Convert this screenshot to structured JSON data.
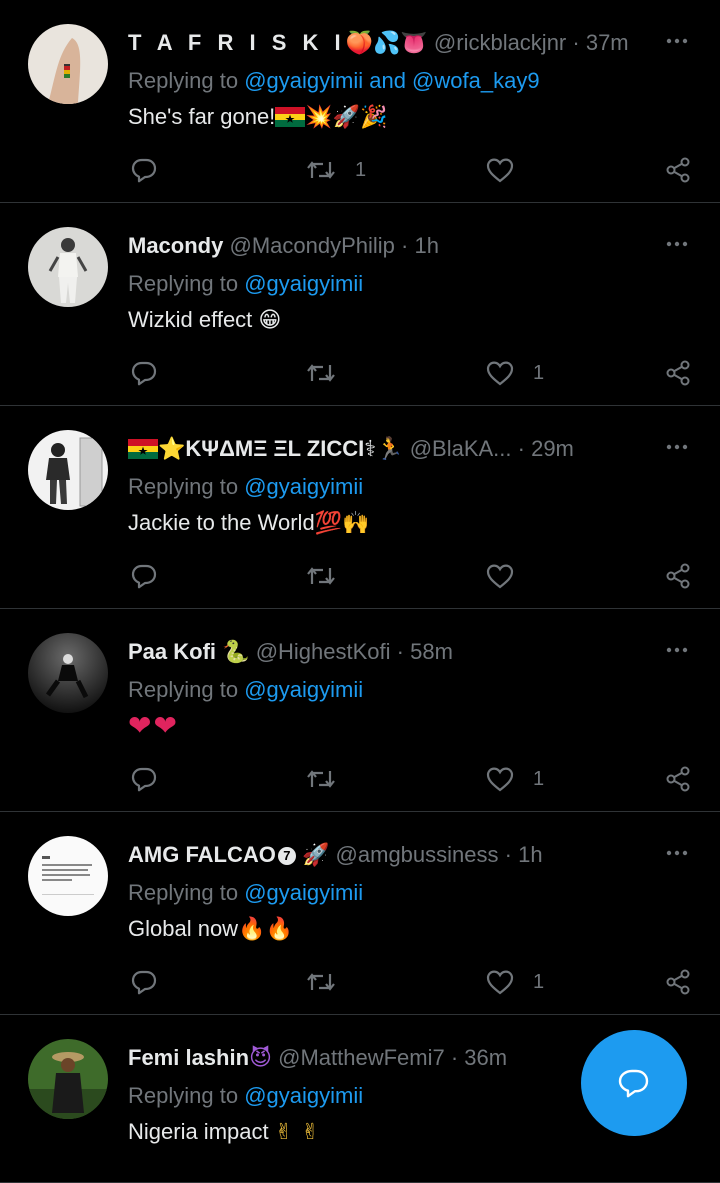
{
  "tweets": [
    {
      "name": "T A F R I S K I",
      "name_emoji": "🍑💦👅",
      "handle": "@rickblackjnr",
      "time": "37m",
      "replying_prefix": "Replying to ",
      "mention_1": "@gyaigyimii",
      "and": " and ",
      "mention_2": "@wofa_kay9",
      "text": "She's far gone!",
      "text_emoji": "💥🚀🎉",
      "retweets": "1",
      "likes": ""
    },
    {
      "name": "Macondy",
      "handle": "@MacondyPhilip",
      "time": "1h",
      "replying_prefix": "Replying to ",
      "mention_1": "@gyaigyimii",
      "text": "Wizkid effect ",
      "text_emoji": "😁",
      "retweets": "",
      "likes": "1"
    },
    {
      "name": "KΨΔMΞ ΞL ZICCI",
      "name_emoji": "⭐",
      "name_emoji_after": "⚕🏃",
      "handle": "@BlaKA...",
      "time": "29m",
      "replying_prefix": "Replying to ",
      "mention_1": "@gyaigyimii",
      "text": "Jackie to the World",
      "text_emoji": "💯🙌",
      "retweets": "",
      "likes": ""
    },
    {
      "name": "Paa Kofi",
      "name_emoji": "🐍",
      "handle": "@HighestKofi",
      "time": "58m",
      "replying_prefix": "Replying to ",
      "mention_1": "@gyaigyimii",
      "text": "",
      "text_emoji": "❤❤",
      "retweets": "",
      "likes": "1"
    },
    {
      "name": "AMG FALCAO",
      "name_badge": "7",
      "name_emoji": "🚀",
      "handle": "@amgbussiness",
      "time": "1h",
      "replying_prefix": "Replying to ",
      "mention_1": "@gyaigyimii",
      "text": "Global now",
      "text_emoji": "🔥🔥",
      "retweets": "",
      "likes": "1"
    },
    {
      "name": "Femi lashin",
      "name_emoji": "😈",
      "handle": "@MatthewFemi7",
      "time": "36m",
      "replying_prefix": "Replying to ",
      "mention_1": "@gyaigyimii",
      "text": "Nigeria impact ",
      "text_emoji": "✌✌",
      "retweets": "",
      "likes": ""
    }
  ],
  "separator": " · ",
  "icons": {
    "reply": "reply-icon",
    "retweet": "retweet-icon",
    "like": "heart-icon",
    "share": "share-icon",
    "more": "more-icon",
    "compose": "compose-reply-icon"
  },
  "colors": {
    "background": "#000000",
    "text": "#e7e9ea",
    "muted": "#71767b",
    "accent": "#1d9bf0",
    "divider": "#2f3336"
  }
}
